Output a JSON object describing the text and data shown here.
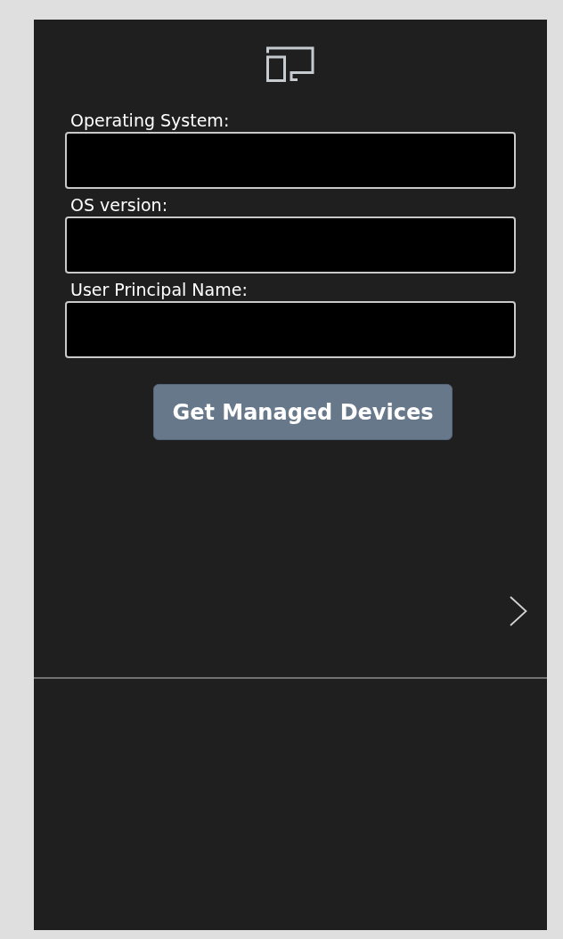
{
  "fields": [
    {
      "label": "Operating System:"
    },
    {
      "label": "OS version:"
    },
    {
      "label": "User Principal Name:"
    }
  ],
  "button": {
    "label": "Get Managed Devices"
  }
}
